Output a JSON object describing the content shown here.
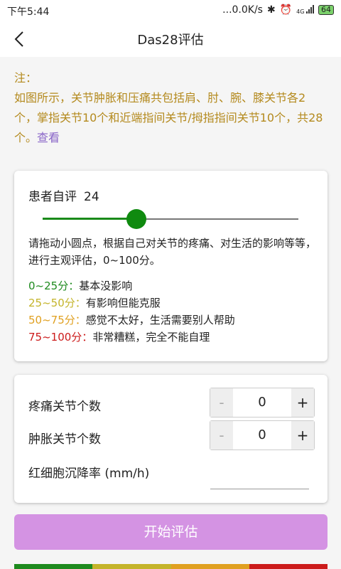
{
  "status_bar": {
    "time": "下午5:44",
    "network_speed": "...0.0K/s",
    "bluetooth": "✱",
    "alarm": "⏰",
    "signal_label": "4G",
    "battery": "64"
  },
  "header": {
    "title": "Das28评估"
  },
  "note": {
    "heading": "注：",
    "body": "如图所示，关节肿胀和压痛共包括肩、肘、腕、膝关节各2个，掌指关节10个和近端指间关节/拇指指间关节10个，共28个。",
    "link": "查看"
  },
  "self_assessment": {
    "label": "患者自评",
    "value": "24",
    "slider_value": 24,
    "slider_max": 100,
    "description": "请拖动小圆点，根据自己对关节的疼痛、对生活的影响等等，  进行主观评估，0~100分。",
    "scale": [
      {
        "range": "0~25分",
        "text": "基本没影响",
        "color": "#1e8a1e"
      },
      {
        "range": "25~50分",
        "text": "有影响但能克服",
        "color": "#c4b42a"
      },
      {
        "range": "50~75分",
        "text": "感觉不太好，生活需要别人帮助",
        "color": "#e0a020"
      },
      {
        "range": "75~100分",
        "text": "非常糟糕，完全不能自理",
        "color": "#cc1b1b"
      }
    ]
  },
  "joints": {
    "tender_label": "疼痛关节个数",
    "tender_value": "0",
    "swollen_label": "肿胀关节个数",
    "swollen_value": "0",
    "esr_label": "红细胞沉降率 (mm/h)",
    "esr_value": "",
    "minus": "-",
    "plus": "+"
  },
  "actions": {
    "start_label": "开始评估",
    "start_color": "#d493e3"
  },
  "colors": {
    "accent_green": "#0f8a0f",
    "note_gold": "#b48a1e",
    "link_purple": "#8a66c8"
  },
  "bottom_strip_colors": [
    "#1e8a1e",
    "#c4b42a",
    "#e0a020",
    "#cc1b1b"
  ]
}
